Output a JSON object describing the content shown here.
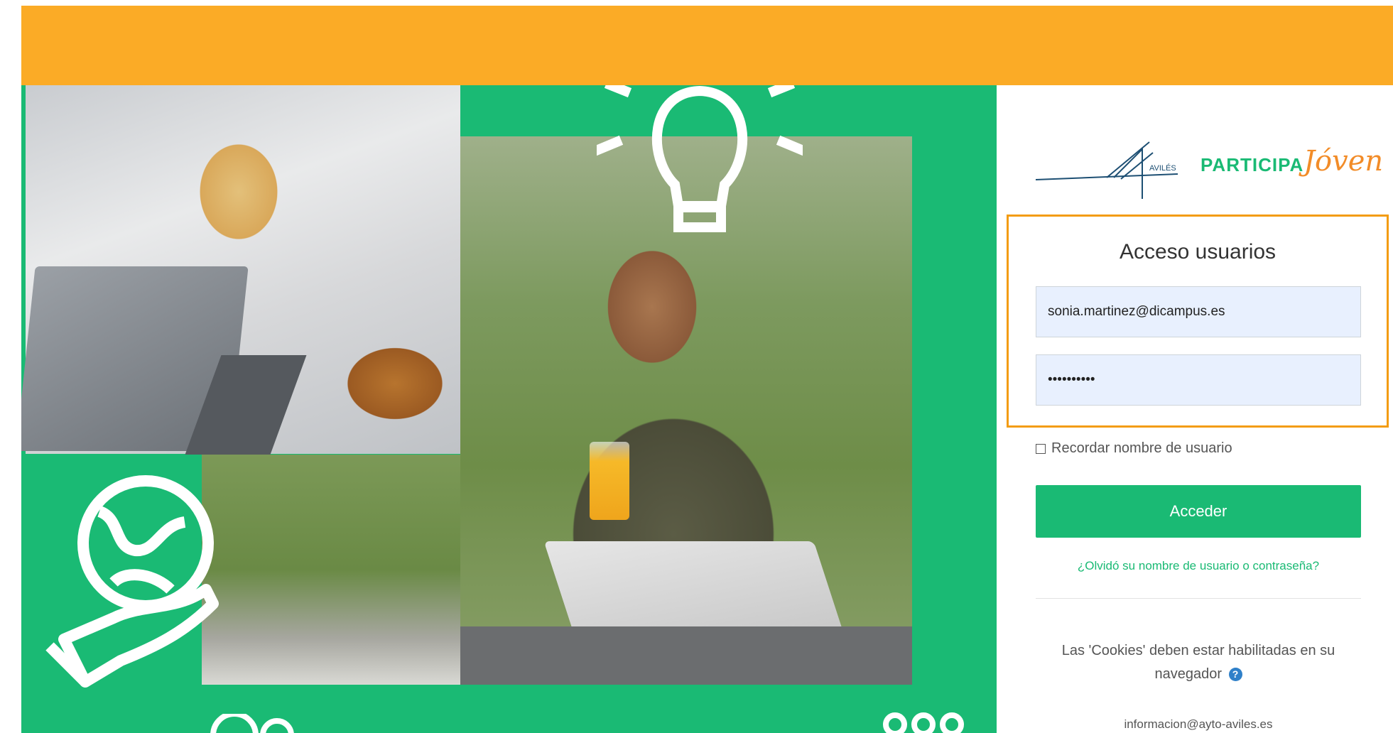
{
  "colors": {
    "header": "#fbab26",
    "hero": "#1aba74",
    "accent": "#1aba74",
    "login_border": "#f39c12",
    "help_icon": "#2f80c9"
  },
  "logo": {
    "city": "AVILÉS",
    "brand": "PARTICIPA",
    "brand_script": "Jóven"
  },
  "login": {
    "title": "Acceso usuarios",
    "username_value": "sonia.martinez@dicampus.es",
    "password_value": "••••••••••",
    "remember_label": "Recordar nombre de usuario",
    "submit_label": "Acceder",
    "forgot_link": "¿Olvidó su nombre de usuario o contraseña?"
  },
  "footer": {
    "cookies_line1": "Las 'Cookies' deben estar habilitadas en su",
    "cookies_line2": "navegador",
    "help_glyph": "?",
    "email": "informacion@ayto-aviles.es"
  },
  "icons": [
    "lightbulb-icon",
    "globe-in-hand-icon",
    "help-icon",
    "checkbox-icon"
  ]
}
